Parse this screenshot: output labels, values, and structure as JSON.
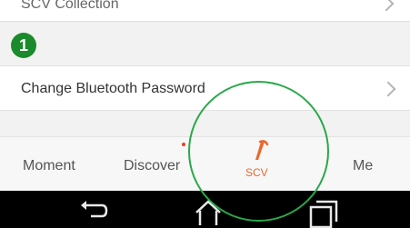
{
  "settings_rows": [
    {
      "label": "SCV Collection"
    },
    {
      "label": "Change Bluetooth Password"
    }
  ],
  "step_badge": "1",
  "tabbar": {
    "tabs": [
      {
        "label": "Moment"
      },
      {
        "label": "Discover"
      },
      {
        "label": "SCV"
      },
      {
        "label": "Me"
      }
    ],
    "active_tab": "SCV",
    "active_color": "#e9692c",
    "notification_dot_color": "#e0412d"
  },
  "android_nav": {
    "buttons": [
      "back-icon",
      "home-icon",
      "recent-apps-icon"
    ]
  },
  "highlight_color": "#2aa84a",
  "badge_color": "#1a8a2c"
}
